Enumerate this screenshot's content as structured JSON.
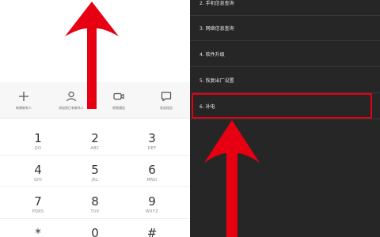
{
  "dialer": {
    "actions": [
      {
        "icon": "plus-icon",
        "label": "新建联系人"
      },
      {
        "icon": "person-icon",
        "label": "添加到已有联系人"
      },
      {
        "icon": "video-icon",
        "label": "视频通话"
      },
      {
        "icon": "message-icon",
        "label": "发送短信"
      }
    ],
    "keys": [
      {
        "digit": "1",
        "sub": "QO"
      },
      {
        "digit": "2",
        "sub": "ABC"
      },
      {
        "digit": "3",
        "sub": "DEF"
      },
      {
        "digit": "4",
        "sub": "GHI"
      },
      {
        "digit": "5",
        "sub": "JKL"
      },
      {
        "digit": "6",
        "sub": "MNO"
      },
      {
        "digit": "7",
        "sub": "PQRS"
      },
      {
        "digit": "8",
        "sub": "TUV"
      },
      {
        "digit": "9",
        "sub": "WXYZ"
      },
      {
        "digit": "*",
        "sub": ""
      },
      {
        "digit": "0",
        "sub": ""
      },
      {
        "digit": "#",
        "sub": ""
      }
    ]
  },
  "settings": {
    "items": [
      {
        "label": "2. 手机信息查询"
      },
      {
        "label": "3. 网络信息查询"
      },
      {
        "label": "4. 软件升级"
      },
      {
        "label": "5. 恢复出厂设置"
      },
      {
        "label": "6. 补电"
      }
    ],
    "highlighted_index": 4,
    "highlight_color": "#e60012"
  },
  "arrow_color": "#e60012"
}
